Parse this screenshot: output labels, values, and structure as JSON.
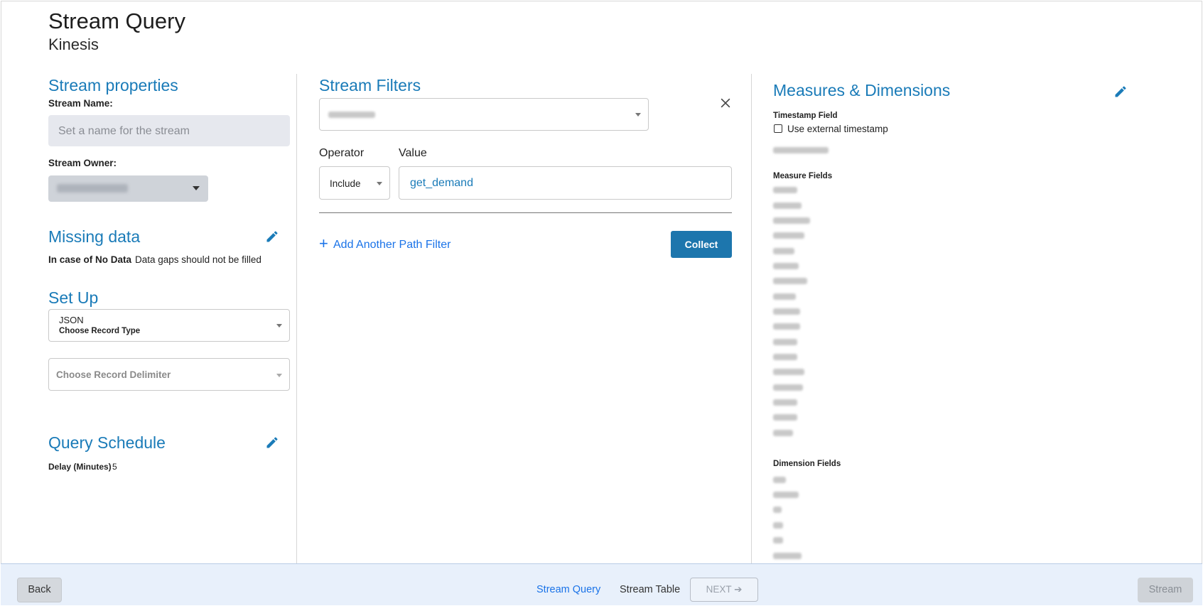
{
  "header": {
    "title": "Stream Query",
    "subtitle": "Kinesis"
  },
  "left": {
    "stream_properties": {
      "title": "Stream properties",
      "name_label": "Stream Name:",
      "name_placeholder": "Set a name for the stream",
      "owner_label": "Stream Owner:"
    },
    "missing_data": {
      "title": "Missing data",
      "case_label": "In case of No Data",
      "case_value": "Data gaps should not be filled"
    },
    "setup": {
      "title": "Set Up",
      "record_type_value": "JSON",
      "record_type_label": "Choose Record Type",
      "delimiter_placeholder": "Choose Record Delimiter"
    },
    "schedule": {
      "title": "Query Schedule",
      "delay_label": "Delay (Minutes)",
      "delay_value": "5"
    }
  },
  "middle": {
    "title": "Stream Filters",
    "operator_label": "Operator",
    "operator_value": "Include",
    "value_label": "Value",
    "value_text": "get_demand",
    "add_filter_label": "Add Another Path Filter",
    "collect_label": "Collect"
  },
  "right": {
    "title": "Measures & Dimensions",
    "timestamp_label": "Timestamp Field",
    "external_ts_label": "Use external timestamp",
    "measure_label": "Measure Fields",
    "dimension_label": "Dimension Fields"
  },
  "footer": {
    "back_label": "Back",
    "step1_label": "Stream Query",
    "step2_label": "Stream Table",
    "next_label": "NEXT ➔",
    "stream_label": "Stream"
  },
  "colors": {
    "accent": "#1a7bb8",
    "primary_button": "#1d76ad",
    "footer_bg": "#e8f0fb"
  },
  "icons": [
    "pencil-icon",
    "close-icon",
    "plus-icon",
    "checkbox-icon",
    "caret-down-icon"
  ]
}
